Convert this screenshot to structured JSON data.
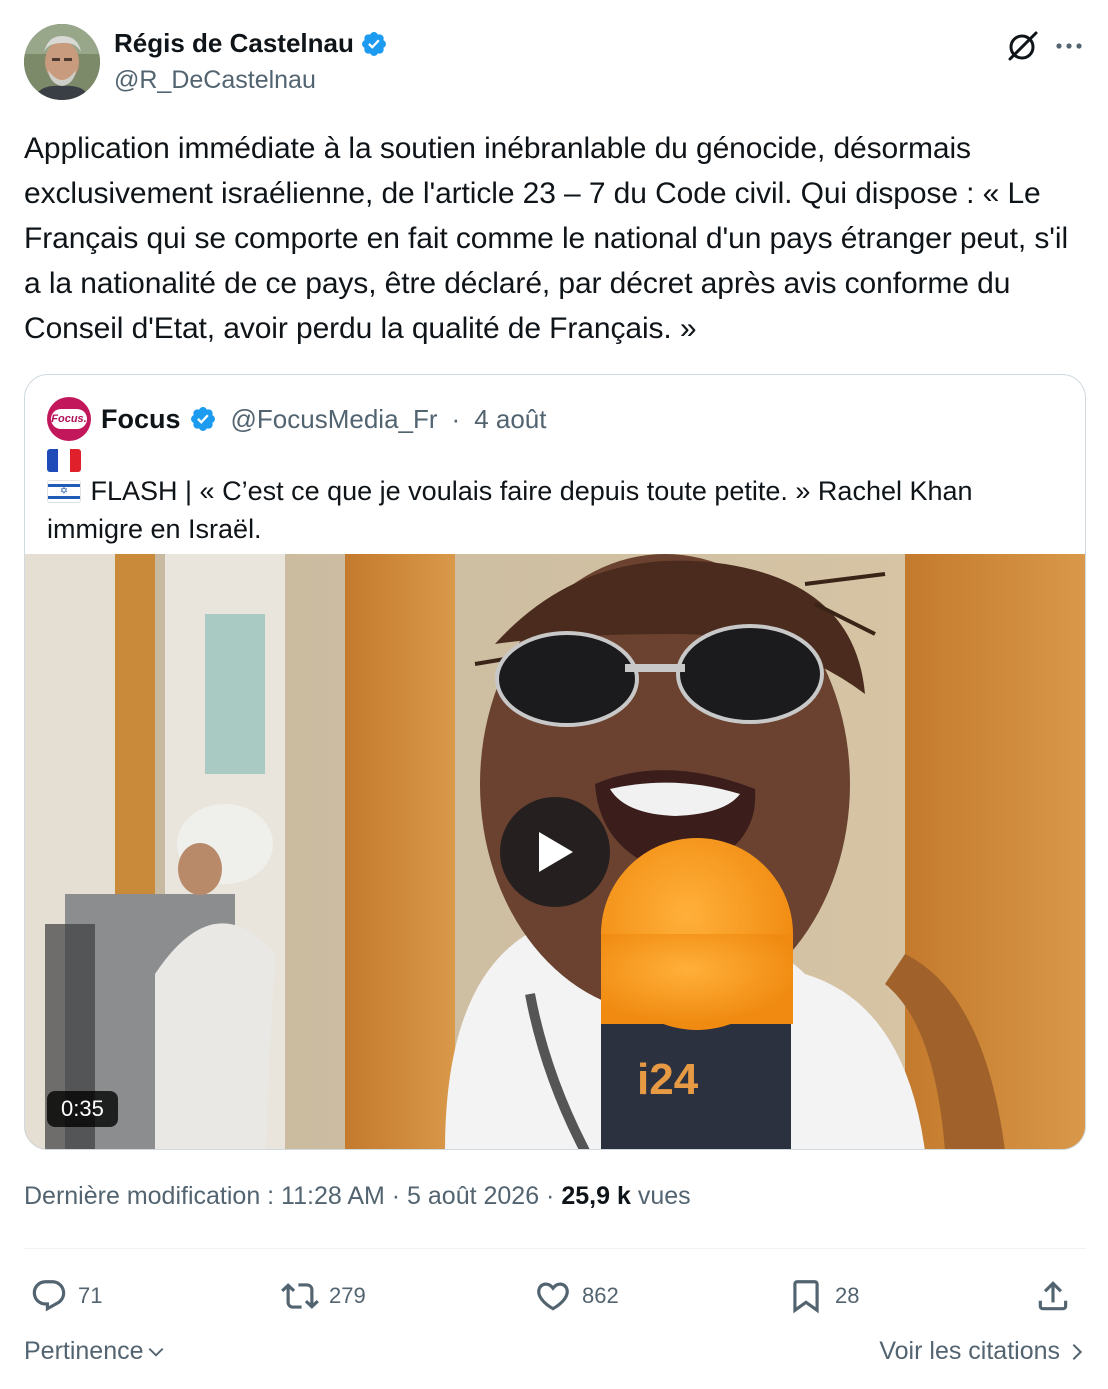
{
  "author": {
    "name": "Régis de Castelnau",
    "handle": "@R_DeCastelnau",
    "verified": true
  },
  "tweet": {
    "text": "Application immédiate à la soutien inébranlable du génocide, désormais exclusivement israélienne, de l'article 23 – 7 du Code civil. Qui dispose : « Le Français qui se comporte en fait comme le national d'un pays étranger peut, s'il a la nationalité de ce pays, être déclaré, par décret après avis conforme du Conseil d'Etat, avoir perdu la qualité de Français. »"
  },
  "quoted": {
    "name": "Focus",
    "logo_text": "Focus.",
    "handle": "@FocusMedia_Fr",
    "separator": "·",
    "date": "4 août",
    "text": "FLASH | « C’est ce que je voulais faire depuis toute petite. » Rachel Khan immigre en Israël.",
    "video": {
      "duration": "0:35",
      "mic_brand": "i24"
    }
  },
  "meta": {
    "prefix": "Dernière modification : 11:28 AM · 5 août 2026 · ",
    "views_count": "25,9 k",
    "views_label": "vues"
  },
  "actions": {
    "replies": "71",
    "retweets": "279",
    "likes": "862",
    "bookmarks": "28"
  },
  "footer": {
    "sort_label": "Pertinence",
    "quotes_link": "Voir les citations"
  },
  "colors": {
    "verified_blue": "#1d9bf0",
    "secondary_text": "#536471",
    "primary_text": "#0f1419",
    "focus_brand": "#c2185b"
  }
}
